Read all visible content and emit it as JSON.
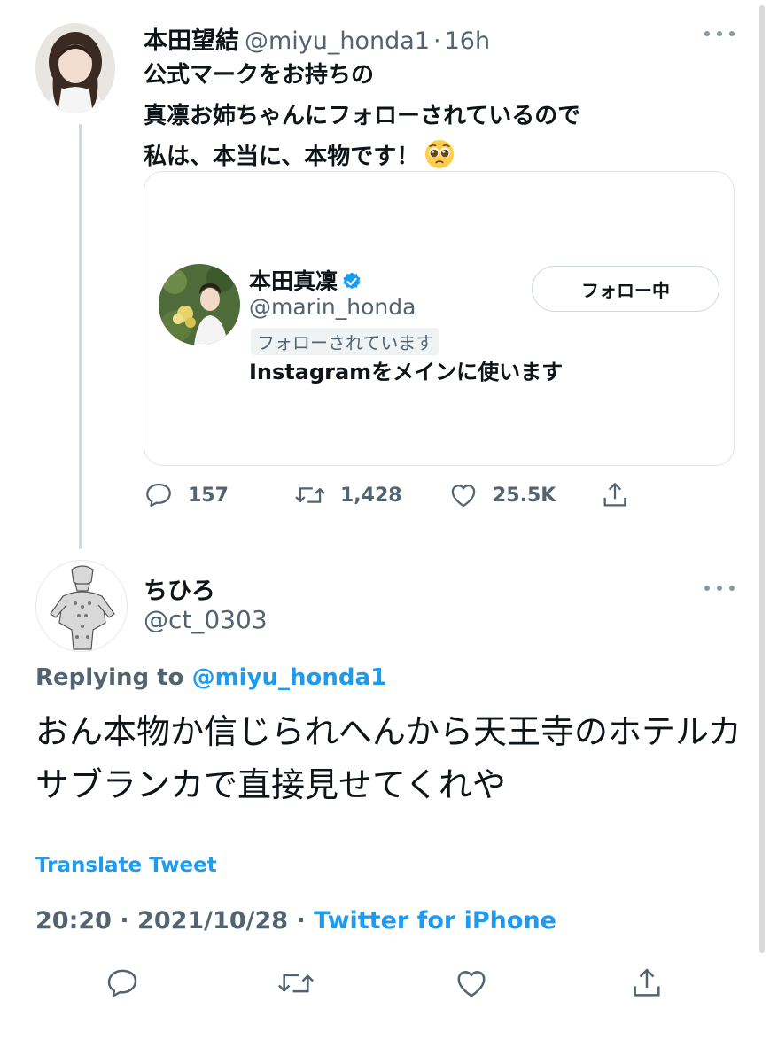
{
  "tweet": {
    "author_name": "本田望結",
    "author_handle": "@miyu_honda1",
    "age": "16h",
    "text_lines": [
      "公式マークをお持ちの",
      "真凛お姉ちゃんにフォローされているので",
      "私は、本当に、本物です！"
    ],
    "emoji": "pleading-face-emoji",
    "stats": {
      "replies": "157",
      "retweets": "1,428",
      "likes": "25.5K"
    }
  },
  "profile_card": {
    "name": "本田真凜",
    "verified": true,
    "handle": "@marin_honda",
    "follows_you": "フォローされています",
    "bio": "Instagramをメインに使います",
    "follow_button": "フォロー中"
  },
  "reply": {
    "author_name": "ちひろ",
    "author_handle": "@ct_0303",
    "replying_prefix": "Replying to",
    "replying_to": "@miyu_honda1",
    "text": "おん本物か信じられへんから天王寺のホテルカサブランカで直接見せてくれや",
    "translate": "Translate Tweet",
    "time": "20:20",
    "date": "2021/10/28",
    "source": "Twitter for iPhone"
  },
  "colors": {
    "accent": "#1d9bf0",
    "secondary_text": "#536471",
    "border": "#cfd9de"
  }
}
